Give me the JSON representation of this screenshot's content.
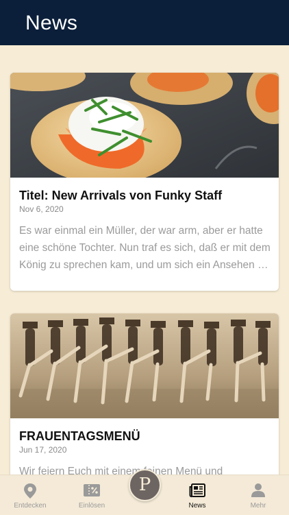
{
  "header": {
    "title": "News"
  },
  "articles": [
    {
      "title": "Titel: New Arrivals von Funky Staff",
      "date": "Nov 6, 2020",
      "excerpt": "Es war einmal ein Müller, der war arm, aber er hatte eine schöne Tochter. Nun traf es sich, daß er mit dem König zu sprechen kam, und um sich ein Ansehen zu geben, sagte er zu ihm"
    },
    {
      "title": "FRAUENTAGSMENÜ",
      "date": "Jun 17, 2020",
      "excerpt": "Wir feiern Euch mit einem feinen Menü und"
    }
  ],
  "tabbar": {
    "items": [
      {
        "label": "Entdecken",
        "icon": "location-pin-icon",
        "active": false
      },
      {
        "label": "Einlösen",
        "icon": "coupon-icon",
        "active": false
      },
      {
        "label": "News",
        "icon": "newspaper-icon",
        "active": true
      },
      {
        "label": "Mehr",
        "icon": "person-icon",
        "active": false
      }
    ],
    "center_logo": "P"
  },
  "colors": {
    "header_bg": "#0b1f3a",
    "page_bg": "#f7ecd6",
    "tab_active": "#111111",
    "tab_inactive": "#9a9a9a",
    "logo_bg": "#6d6562"
  }
}
